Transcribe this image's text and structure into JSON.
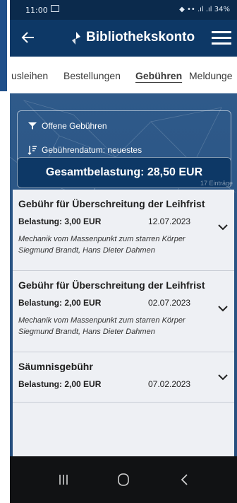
{
  "status": {
    "time": "11:00",
    "right": "◆ •• .ıl .ıl 34%"
  },
  "header": {
    "title": "Bibliothekskonto"
  },
  "tabs": [
    {
      "label": "usleihen"
    },
    {
      "label": "Bestellungen"
    },
    {
      "label": "Gebühren"
    },
    {
      "label": "Meldunge"
    }
  ],
  "filter": {
    "open_fees": "Offene Gebühren",
    "sort": "Gebührendatum: neuestes"
  },
  "total": {
    "label": "Gesamtbelastung: 28,50 EUR"
  },
  "count": "17 Einträge",
  "fees": [
    {
      "title": "Gebühr für Überschreitung der Leihfrist",
      "amount": "Belastung: 3,00 EUR",
      "date": "12.07.2023",
      "desc": "Mechanik vom Massenpunkt zum starren Körper Siegmund Brandt, Hans Dieter Dahmen"
    },
    {
      "title": "Gebühr für Überschreitung der Leihfrist",
      "amount": "Belastung: 2,00 EUR",
      "date": "02.07.2023",
      "desc": "Mechanik vom Massenpunkt zum starren Körper Siegmund Brandt, Hans Dieter Dahmen"
    },
    {
      "title": "Säumnisgebühr",
      "amount": "Belastung: 2,00 EUR",
      "date": "07.02.2023",
      "desc": ""
    }
  ],
  "colors": {
    "header": "#0d3866",
    "content": "#2a5585",
    "card": "#eef0f4",
    "nav": "#111214"
  }
}
